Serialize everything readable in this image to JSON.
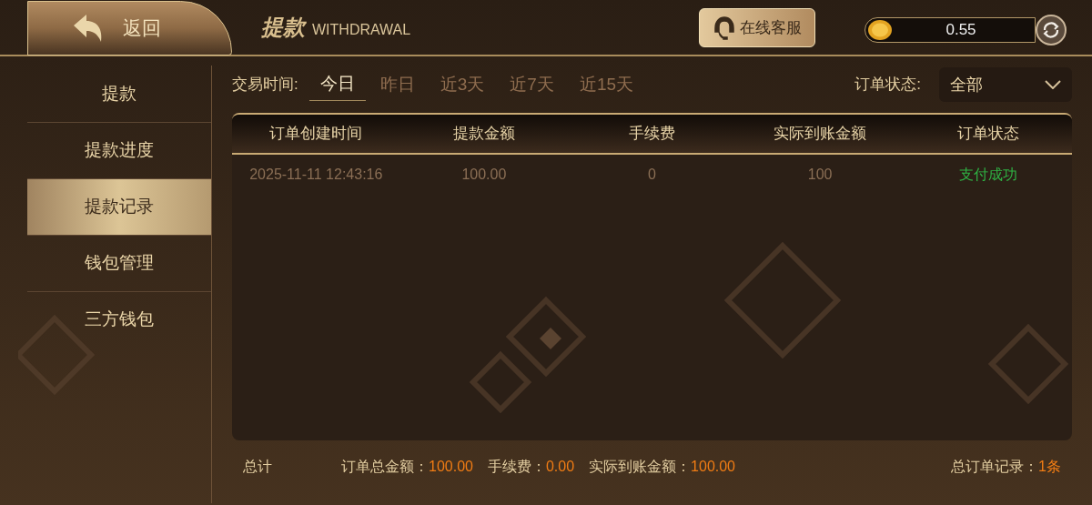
{
  "header": {
    "back_label": "返回",
    "title": "提款",
    "subtitle": "WITHDRAWAL",
    "support_label": "在线客服",
    "balance": "0.55"
  },
  "sidebar": {
    "items": [
      {
        "label": "提款",
        "selected": false
      },
      {
        "label": "提款进度",
        "selected": false
      },
      {
        "label": "提款记录",
        "selected": true
      },
      {
        "label": "钱包管理",
        "selected": false
      },
      {
        "label": "三方钱包",
        "selected": false
      }
    ]
  },
  "filters": {
    "time_label": "交易时间:",
    "time_tabs": [
      {
        "label": "今日",
        "selected": true
      },
      {
        "label": "昨日",
        "selected": false
      },
      {
        "label": "近3天",
        "selected": false
      },
      {
        "label": "近7天",
        "selected": false
      },
      {
        "label": "近15天",
        "selected": false
      }
    ],
    "status_label": "订单状态:",
    "status_value": "全部"
  },
  "table": {
    "columns": [
      "订单创建时间",
      "提款金额",
      "手续费",
      "实际到账金额",
      "订单状态"
    ],
    "rows": [
      {
        "cells": [
          "2025-11-11 12:43:16",
          "100.00",
          "0",
          "100",
          "支付成功"
        ],
        "color": "#2fb344"
      }
    ]
  },
  "summary": {
    "label": "总计",
    "items": [
      {
        "label": "订单总金额：",
        "value": "100.00"
      },
      {
        "label": "手续费：",
        "value": "0.00"
      },
      {
        "label": "实际到账金额：",
        "value": "100.00"
      }
    ],
    "count_label": "总订单记录：",
    "count_value": "1条"
  }
}
